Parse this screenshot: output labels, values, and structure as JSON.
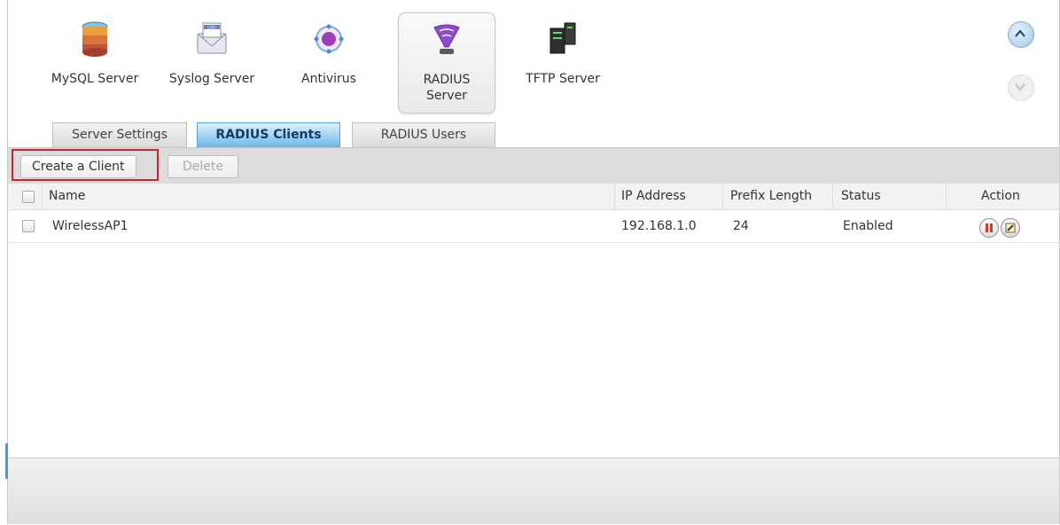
{
  "apps": [
    {
      "label": "MySQL Server",
      "icon": "database-icon",
      "active": false
    },
    {
      "label": "Syslog Server",
      "icon": "log-envelope-icon",
      "active": false
    },
    {
      "label": "Antivirus",
      "icon": "virus-icon",
      "active": false
    },
    {
      "label": "RADIUS Server",
      "icon": "radius-antenna-icon",
      "active": true
    },
    {
      "label": "TFTP Server",
      "icon": "server-rack-icon",
      "active": false
    }
  ],
  "scroll": {
    "up_icon": "chevron-up-icon",
    "down_icon": "chevron-down-icon"
  },
  "tabs": [
    {
      "label": "Server Settings",
      "active": false
    },
    {
      "label": "RADIUS Clients",
      "active": true
    },
    {
      "label": "RADIUS Users",
      "active": false
    }
  ],
  "toolbar": {
    "create_label": "Create a Client",
    "delete_label": "Delete"
  },
  "table": {
    "columns": [
      "Name",
      "IP Address",
      "Prefix Length",
      "Status",
      "Action"
    ],
    "rows": [
      {
        "name": "WirelessAP1",
        "ip": "192.168.1.0",
        "prefix": "24",
        "status": "Enabled",
        "actions": [
          "pause-icon",
          "edit-icon"
        ]
      }
    ]
  },
  "colors": {
    "active_tab": "#6fb7e9",
    "highlight": "#c1272d",
    "pause": "#d9381e"
  }
}
